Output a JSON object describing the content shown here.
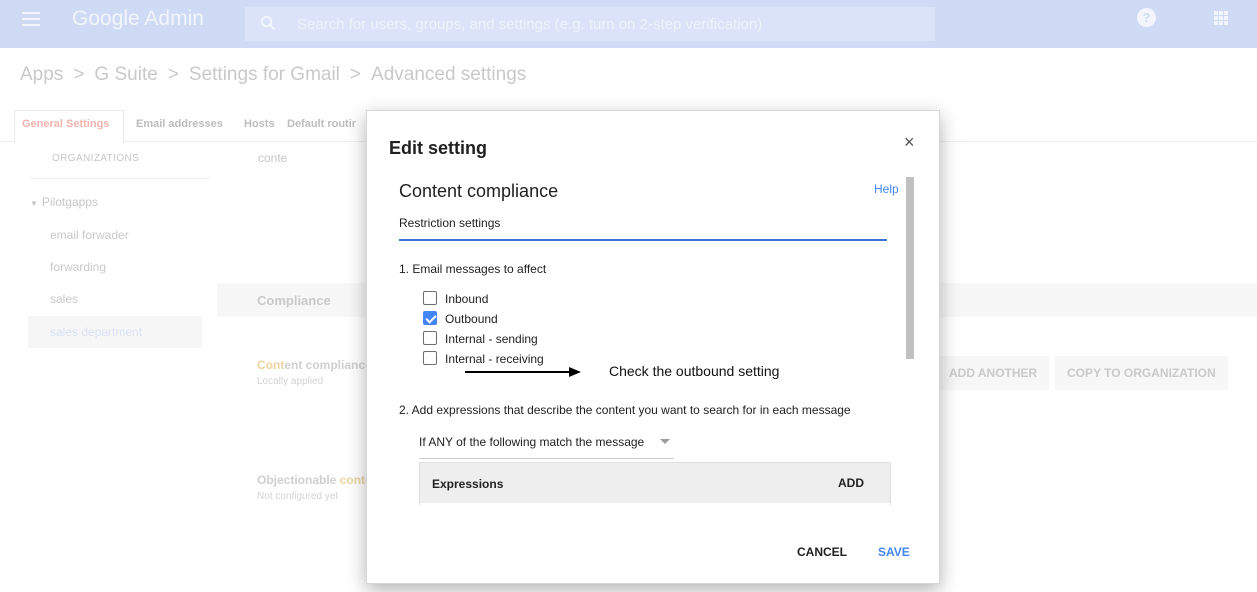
{
  "header": {
    "brand": "Google Admin",
    "search_placeholder": "Search for users, groups, and settings (e.g. turn on 2-step verification)",
    "help_icon_glyph": "?",
    "icons": [
      "menu-icon",
      "search-icon",
      "help-icon",
      "apps-grid-icon"
    ]
  },
  "breadcrumb": {
    "items": [
      "Apps",
      "G Suite",
      "Settings for Gmail",
      "Advanced settings"
    ],
    "separator": ">"
  },
  "tabs": [
    {
      "label": "General Settings",
      "active": true
    },
    {
      "label": "Email addresses",
      "active": false
    },
    {
      "label": "Hosts",
      "active": false
    },
    {
      "label": "Default routir",
      "active": false
    }
  ],
  "sidebar": {
    "header": "ORGANIZATIONS",
    "filter_value": "conte",
    "root": "Pilotgapps",
    "items": [
      {
        "label": "email forwader",
        "selected": false
      },
      {
        "label": "forwarding",
        "selected": false
      },
      {
        "label": "sales",
        "selected": false
      },
      {
        "label": "sales department",
        "selected": true
      }
    ]
  },
  "main": {
    "section_label": "Compliance",
    "content_compliance": {
      "highlight": "Cont",
      "rest": "ent compliance",
      "status": "Locally applied"
    },
    "objectionable": {
      "prefix": "Objectionable ",
      "highlight": "conte",
      "status": "Not configured yet"
    },
    "add_another_label": "ADD ANOTHER",
    "copy_label": "COPY TO ORGANIZATION"
  },
  "dialog": {
    "title": "Edit setting",
    "close_glyph": "×",
    "section_title": "Content compliance",
    "help_label": "Help",
    "subsection": "Restriction settings",
    "q1": "1. Email messages to affect",
    "checkboxes": [
      {
        "label": "Inbound",
        "checked": false
      },
      {
        "label": "Outbound",
        "checked": true
      },
      {
        "label": "Internal - sending",
        "checked": false
      },
      {
        "label": "Internal - receiving",
        "checked": false
      }
    ],
    "annotation": "Check the outbound setting",
    "q2": "2. Add expressions that describe the content you want to search for in each message",
    "match_select": "If ANY of the following match the message",
    "expressions_header": "Expressions",
    "add_label": "ADD",
    "cancel_label": "CANCEL",
    "save_label": "SAVE"
  },
  "colors": {
    "topbar": "#cfdbf5",
    "accent_blue": "#4285f4",
    "underline_blue": "#3f73d8",
    "active_tab": "#f0b3ad",
    "highlight": "#ecd39e"
  }
}
